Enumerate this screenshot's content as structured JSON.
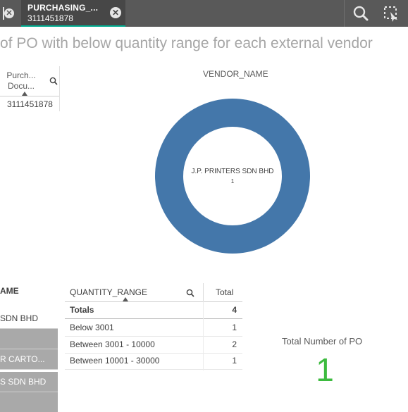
{
  "selections_bar": {
    "tab": {
      "field": "PURCHASING_...",
      "value": "3111451878"
    }
  },
  "sheet_title": "of PO with below quantity range for each external vendor",
  "left_table": {
    "header": "Purch...\nDocu...",
    "header_line1": "Purch...",
    "header_line2": "Docu...",
    "value": "3111451878"
  },
  "donut_chart": {
    "dimension_label": "VENDOR_NAME",
    "center_label": "J.P. PRINTERS SDN BHD",
    "center_value": "1",
    "color": "#4477aa"
  },
  "chart_data": {
    "type": "pie",
    "categories": [
      "J.P. PRINTERS SDN BHD"
    ],
    "values": [
      1
    ],
    "title": "VENDOR_NAME"
  },
  "vendor_filter": {
    "header": "AME",
    "items": [
      {
        "label": "SDN BHD",
        "state": "selected"
      },
      {
        "label": "",
        "state": "excluded"
      },
      {
        "label": "R CARTO...",
        "state": "excluded"
      },
      {
        "label": "S SDN BHD",
        "state": "excluded"
      },
      {
        "label": "",
        "state": "excluded"
      }
    ]
  },
  "quantity_table": {
    "col1_header": "QUANTITY_RANGE",
    "col2_header": "Total",
    "totals_label": "Totals",
    "totals_value": "4",
    "rows": [
      {
        "range": "Below 3001",
        "total": "1"
      },
      {
        "range": "Between 3001 - 10000",
        "total": "2"
      },
      {
        "range": "Between 10001 - 30000",
        "total": "1"
      }
    ]
  },
  "kpi": {
    "label": "Total Number of PO",
    "value": "1",
    "color": "#3dbb3f"
  }
}
